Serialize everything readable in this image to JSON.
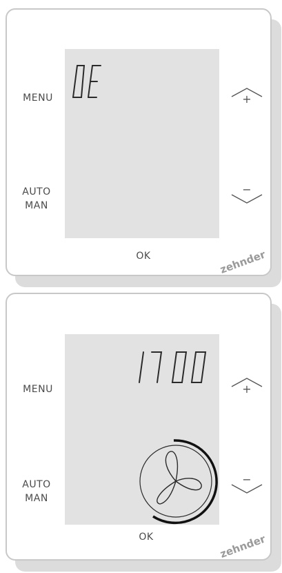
{
  "devices": [
    {
      "menu_label": "MENU",
      "auto_label": "AUTO",
      "man_label": "MAN",
      "ok_label": "OK",
      "display_text": "DE",
      "up_symbol": "+",
      "down_symbol": "−",
      "brand": "zehnder"
    },
    {
      "menu_label": "MENU",
      "auto_label": "AUTO",
      "man_label": "MAN",
      "ok_label": "OK",
      "display_text": "17 00",
      "up_symbol": "+",
      "down_symbol": "−",
      "brand": "zehnder",
      "fan_icon": "fan-icon"
    }
  ]
}
